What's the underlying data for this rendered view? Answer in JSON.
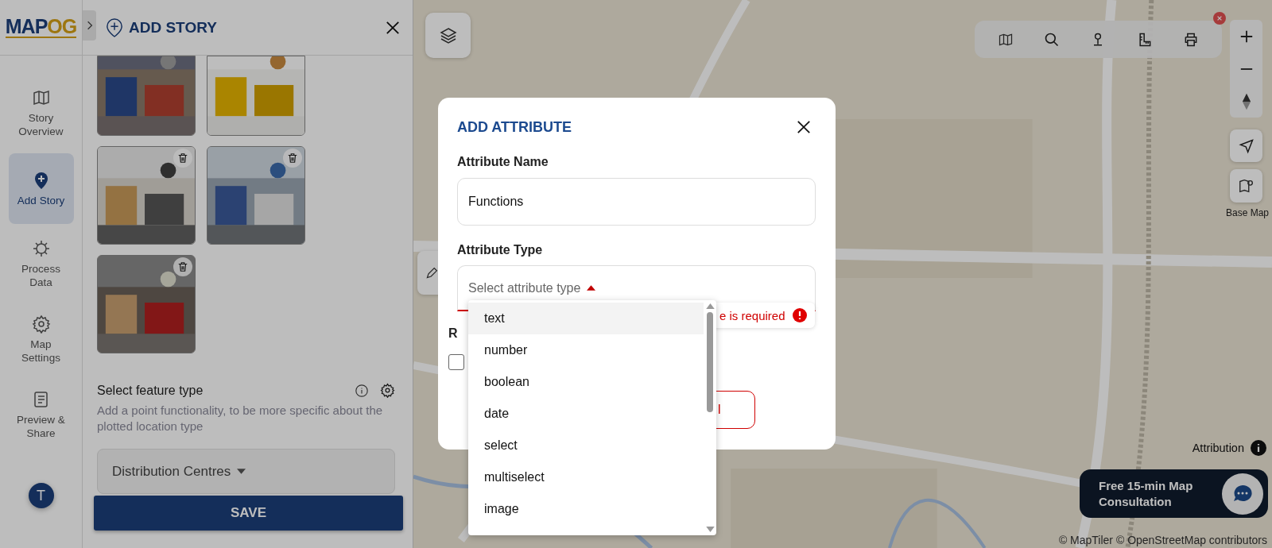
{
  "sidebar": {
    "logo": "MAPOG",
    "avatar": "T",
    "items": [
      {
        "label": "Story Overview",
        "kind": "map",
        "selected": false
      },
      {
        "label": "Add Story",
        "kind": "pin",
        "selected": true
      },
      {
        "label": "Process Data",
        "kind": "cog",
        "selected": false
      },
      {
        "label": "Map Settings",
        "kind": "gear",
        "selected": false
      },
      {
        "label": "Preview & Share",
        "kind": "list",
        "selected": false
      }
    ]
  },
  "panel": {
    "title": "ADD STORY",
    "images": [
      {
        "kind": "picture",
        "trash": false
      },
      {
        "kind": "picture",
        "trash": false
      },
      {
        "kind": "picture",
        "trash": true
      },
      {
        "kind": "picture",
        "trash": true
      },
      {
        "kind": "picture",
        "trash": true
      }
    ],
    "feature_title": "Select feature type",
    "feature_description": "Add a point functionality, to be more specific about the plotted location type",
    "feature_value": "Distribution Centres",
    "save": "SAVE"
  },
  "map": {
    "base_map_label": "Base Map",
    "attribution": "Attribution",
    "consultation": "Free 15-min Map Consultation",
    "copyright": "© MapTiler © OpenStreetMap contributors"
  },
  "dialog": {
    "title": "ADD ATTRIBUTE",
    "name_label": "Attribute Name",
    "name_value": "Functions",
    "type_label": "Attribute Type",
    "type_placeholder": "Select attribute type",
    "error": "e is required",
    "required_label": "R",
    "required_checked": false,
    "button_label": "l",
    "options": [
      {
        "label": "text",
        "selected": true
      },
      {
        "label": "number",
        "selected": false
      },
      {
        "label": "boolean",
        "selected": false
      },
      {
        "label": "date",
        "selected": false
      },
      {
        "label": "select",
        "selected": false
      },
      {
        "label": "multiselect",
        "selected": false
      },
      {
        "label": "image",
        "selected": false
      }
    ]
  }
}
